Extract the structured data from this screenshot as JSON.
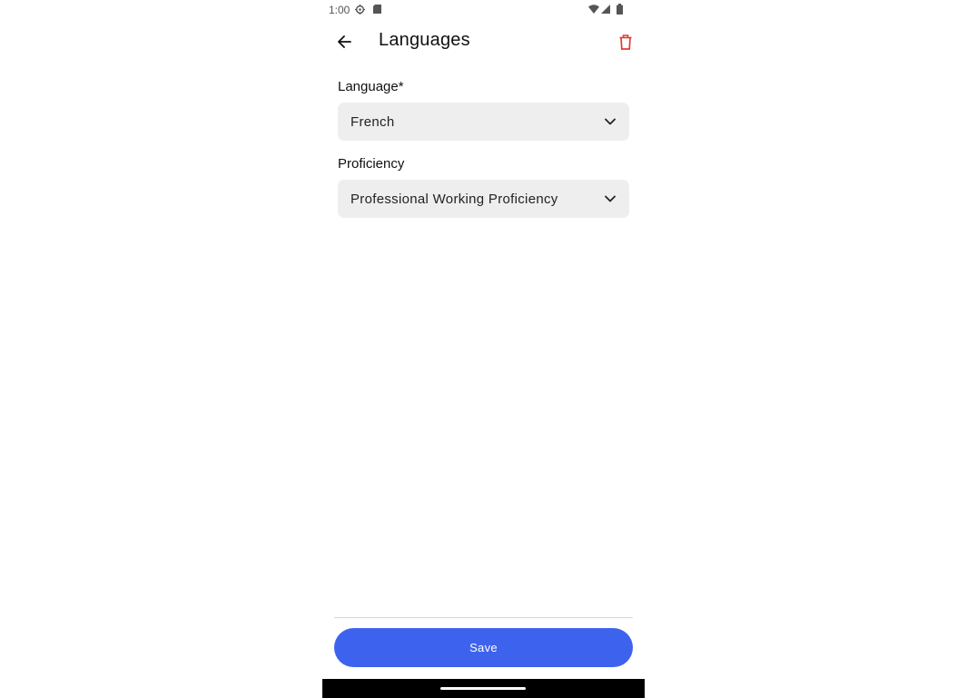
{
  "status_bar": {
    "time": "1:00",
    "icons": [
      "settings-gear-icon",
      "sd-card-icon",
      "wifi-icon",
      "signal-icon",
      "battery-icon"
    ]
  },
  "app_bar": {
    "title": "Languages",
    "back_icon": "arrow-left-icon",
    "delete_icon": "trash-icon",
    "delete_color": "#e53935"
  },
  "form": {
    "language": {
      "label": "Language*",
      "value": "French",
      "icon": "chevron-down-icon"
    },
    "proficiency": {
      "label": "Proficiency",
      "value": "Professional Working Proficiency",
      "icon": "chevron-down-icon"
    }
  },
  "footer": {
    "save_label": "Save",
    "accent_color": "#3d63ee"
  }
}
